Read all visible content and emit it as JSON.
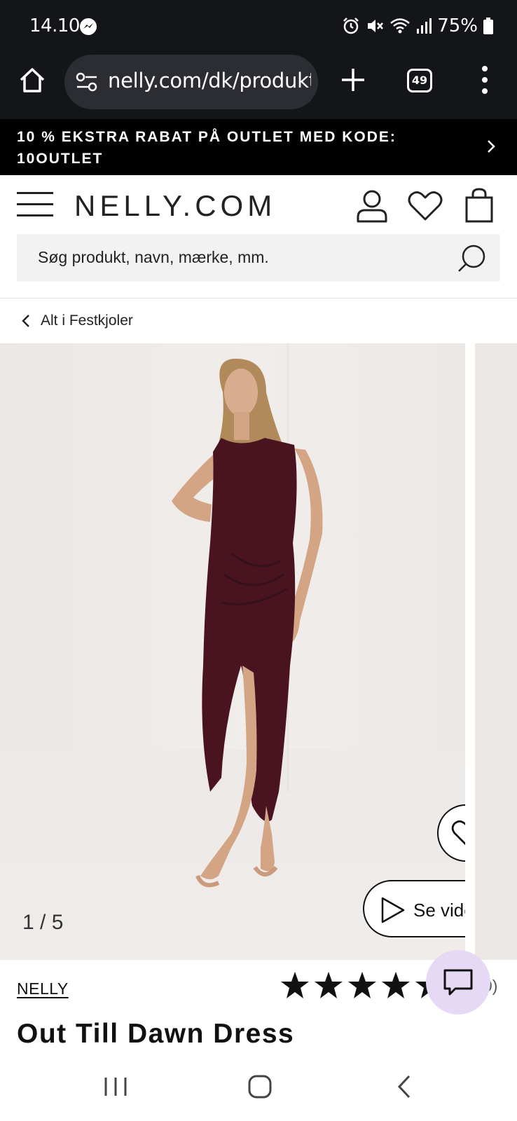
{
  "status_bar": {
    "time": "14.10",
    "battery": "75%"
  },
  "browser": {
    "url": "nelly.com/dk/produkt",
    "tab_count": "49"
  },
  "promo": {
    "text": "10 % EKSTRA RABAT PÅ OUTLET MED KODE: 10OUTLET"
  },
  "header": {
    "logo": "NELLY.COM",
    "search_placeholder": "Søg produkt, navn, mærke, mm."
  },
  "breadcrumb": {
    "label": "Alt i Festkjoler"
  },
  "gallery": {
    "counter": "1 / 5",
    "video_label": "Se video"
  },
  "product": {
    "brand": "NELLY",
    "name": "Out Till Dawn Dress",
    "rating_stars": 5,
    "rating_count_partial": "9)"
  },
  "colors": {
    "dress": "#4a1320",
    "chat_bg": "#e6d9f5",
    "status_bar_bg": "#141518"
  },
  "icons": [
    "home-icon",
    "site-settings-icon",
    "plus-icon",
    "tabs-icon",
    "more-vert-icon",
    "chevron-right-icon",
    "menu-icon",
    "user-icon",
    "heart-icon",
    "bag-icon",
    "search-icon",
    "chevron-left-icon",
    "play-icon",
    "chat-icon",
    "star-icon"
  ]
}
